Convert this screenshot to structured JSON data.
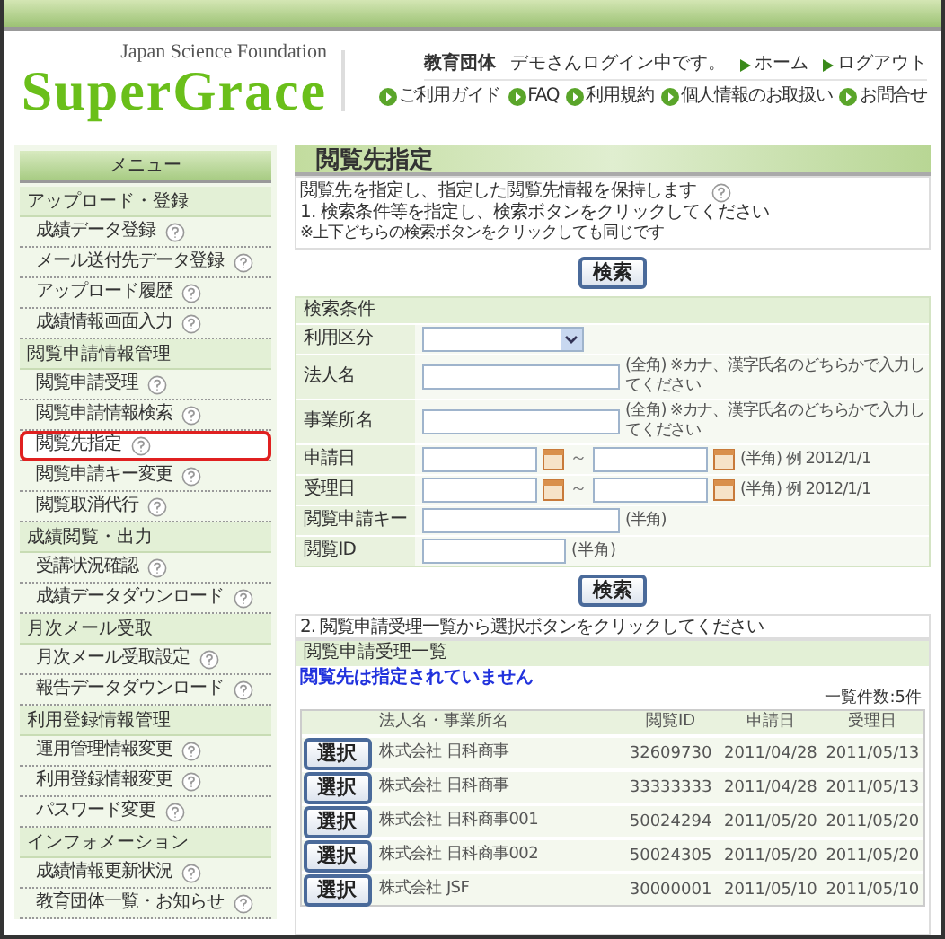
{
  "header": {
    "tagline": "Japan Science Foundation",
    "logo": "SuperGrace",
    "user_type": "教育団体",
    "login_status": "デモさんログイン中です。",
    "top_links": [
      "ホーム",
      "ログアウト"
    ],
    "nav_links": [
      "ご利用ガイド",
      "FAQ",
      "利用規約",
      "個人情報のお取扱い",
      "お問合せ"
    ]
  },
  "sidebar": {
    "title": "メニュー",
    "sections": [
      {
        "title": "アップロード・登録",
        "items": [
          {
            "label": "成績データ登録",
            "selected": false
          },
          {
            "label": "メール送付先データ登録",
            "selected": false
          },
          {
            "label": "アップロード履歴",
            "selected": false
          },
          {
            "label": "成績情報画面入力",
            "selected": false
          }
        ]
      },
      {
        "title": "閲覧申請情報管理",
        "items": [
          {
            "label": "閲覧申請受理",
            "selected": false
          },
          {
            "label": "閲覧申請情報検索",
            "selected": false
          },
          {
            "label": "閲覧先指定",
            "selected": true
          },
          {
            "label": "閲覧申請キー変更",
            "selected": false
          },
          {
            "label": "閲覧取消代行",
            "selected": false
          }
        ]
      },
      {
        "title": "成績閲覧・出力",
        "items": [
          {
            "label": "受講状況確認",
            "selected": false
          },
          {
            "label": "成績データダウンロード",
            "selected": false
          }
        ]
      },
      {
        "title": "月次メール受取",
        "items": [
          {
            "label": "月次メール受取設定",
            "selected": false
          },
          {
            "label": "報告データダウンロード",
            "selected": false
          }
        ]
      },
      {
        "title": "利用登録情報管理",
        "items": [
          {
            "label": "運用管理情報変更",
            "selected": false
          },
          {
            "label": "利用登録情報変更",
            "selected": false
          },
          {
            "label": "パスワード変更",
            "selected": false
          }
        ]
      },
      {
        "title": "インフォメーション",
        "items": [
          {
            "label": "成績情報更新状況",
            "selected": false
          },
          {
            "label": "教育団体一覧・お知らせ",
            "selected": false
          }
        ]
      }
    ]
  },
  "page": {
    "title": "閲覧先指定",
    "description": [
      "閲覧先を指定し、指定した閲覧先情報を保持します",
      "1. 検索条件等を指定し、検索ボタンをクリックしてください",
      "※上下どちらの検索ボタンをクリックしても同じです"
    ],
    "search_button_top": "検索",
    "conditions": {
      "title": "検索条件",
      "fields": [
        {
          "kind": "select",
          "label": "利用区分"
        },
        {
          "kind": "text",
          "label": "法人名",
          "hint": "(全角) ※カナ、漢字氏名のどちらかで入力してください"
        },
        {
          "kind": "text",
          "label": "事業所名",
          "hint": "(全角) ※カナ、漢字氏名のどちらかで入力してください"
        },
        {
          "kind": "date_range",
          "label": "申請日",
          "separator": "～",
          "hint": "(半角) 例 2012/1/1"
        },
        {
          "kind": "date_range",
          "label": "受理日",
          "separator": "～",
          "hint": "(半角) 例 2012/1/1"
        },
        {
          "kind": "text",
          "label": "閲覧申請キー",
          "hint": "(半角)"
        },
        {
          "kind": "short_text",
          "label": "閲覧ID",
          "hint": "(半角)"
        }
      ]
    },
    "search_button_bottom": "検索",
    "step2": "2. 閲覧申請受理一覧から選択ボタンをクリックしてください",
    "list": {
      "title": "閲覧申請受理一覧",
      "notice": "閲覧先は指定されていません",
      "count": "一覧件数:5件",
      "columns": [
        "法人名・事業所名",
        "閲覧ID",
        "申請日",
        "受理日"
      ],
      "rows": [
        {
          "button": "選択",
          "name": "株式会社 日科商事",
          "id": "32609730",
          "applied": "2011/04/28",
          "accepted": "2011/05/13"
        },
        {
          "button": "選択",
          "name": "株式会社 日科商事",
          "id": "33333333",
          "applied": "2011/04/28",
          "accepted": "2011/05/13"
        },
        {
          "button": "選択",
          "name": "株式会社 日科商事001",
          "id": "50024294",
          "applied": "2011/05/20",
          "accepted": "2011/05/20"
        },
        {
          "button": "選択",
          "name": "株式会社 日科商事002",
          "id": "50024305",
          "applied": "2011/05/20",
          "accepted": "2011/05/20"
        },
        {
          "button": "選択",
          "name": "株式会社 JSF",
          "id": "30000001",
          "applied": "2011/05/10",
          "accepted": "2011/05/10"
        }
      ]
    }
  }
}
